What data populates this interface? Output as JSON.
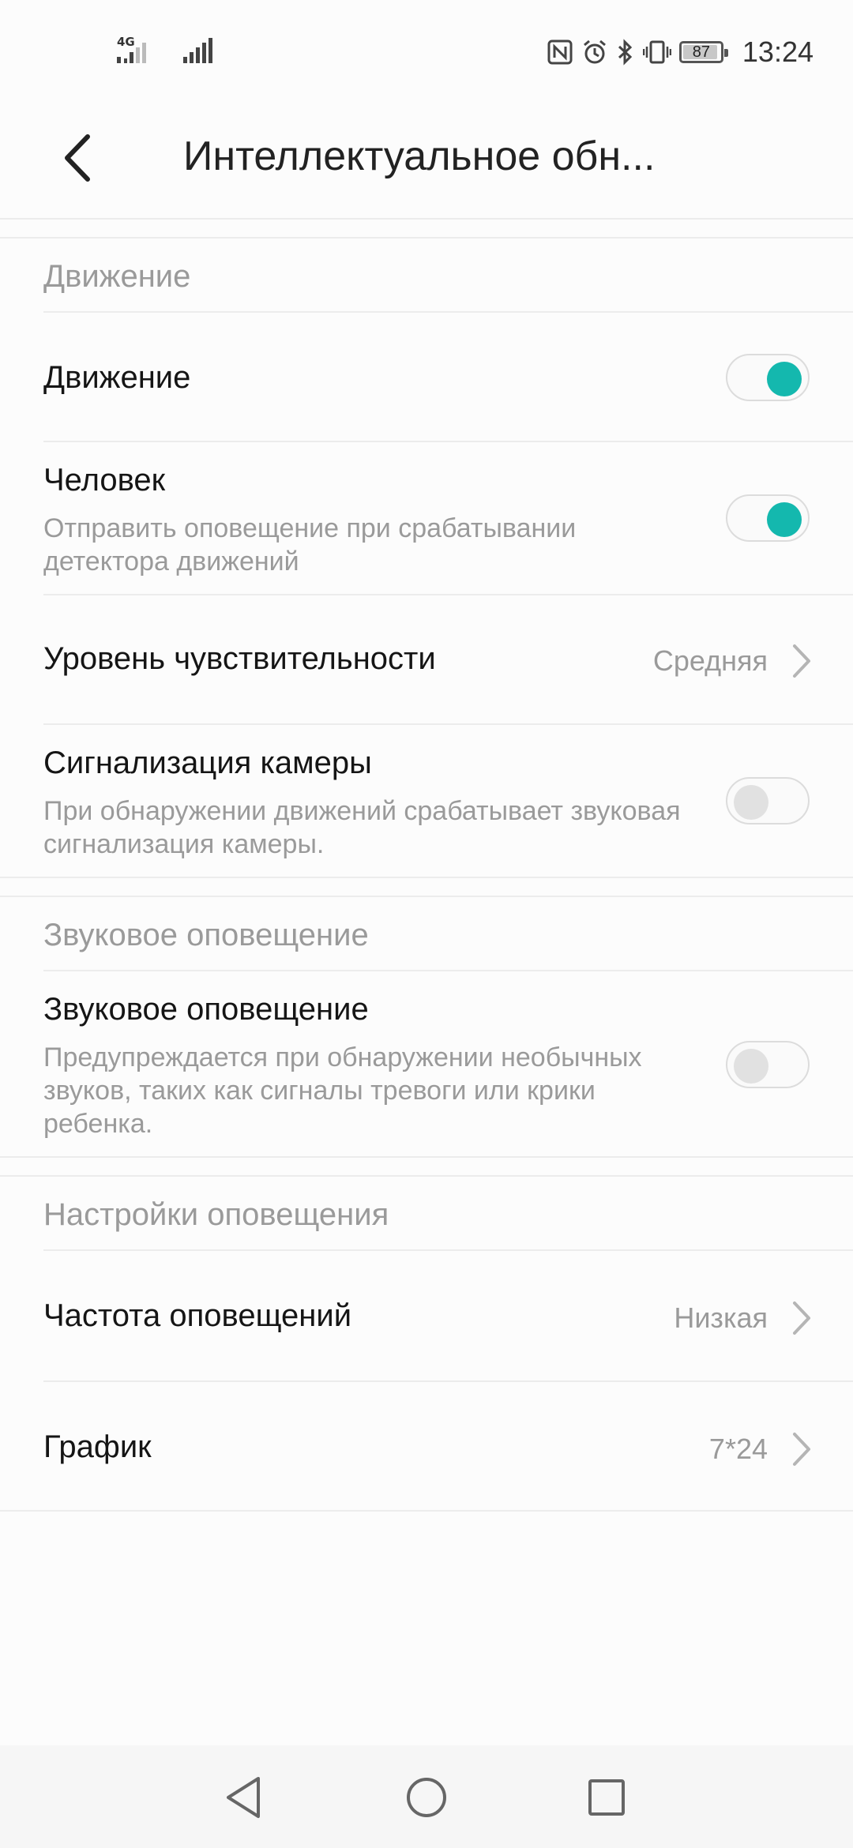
{
  "status_bar": {
    "network_type": "4G",
    "battery_level": "87",
    "time": "13:24"
  },
  "header": {
    "title": "Интеллектуальное обн..."
  },
  "sections": {
    "motion": {
      "header": "Движение",
      "motion_item": {
        "title": "Движение",
        "enabled": true
      },
      "human_item": {
        "title": "Человек",
        "subtitle": "Отправить оповещение при срабатывании детектора движений",
        "enabled": true
      },
      "sensitivity_item": {
        "title": "Уровень чувствительности",
        "value": "Средняя"
      },
      "camera_alarm_item": {
        "title": "Сигнализация камеры",
        "subtitle": "При обнаружении движений срабатывает звуковая сигнализация камеры.",
        "enabled": false
      }
    },
    "sound": {
      "header": "Звуковое оповещение",
      "sound_item": {
        "title": "Звуковое оповещение",
        "subtitle": "Предупреждается при обнаружении необычных звуков, таких как сигналы тревоги или крики ребенка.",
        "enabled": false
      }
    },
    "notifications": {
      "header": "Настройки оповещения",
      "frequency_item": {
        "title": "Частота оповещений",
        "value": "Низкая"
      },
      "schedule_item": {
        "title": "График",
        "value": "7*24"
      }
    }
  },
  "colors": {
    "accent": "#14b8ae",
    "secondary_text": "#9a9a9a",
    "background": "#fcfcfc"
  }
}
